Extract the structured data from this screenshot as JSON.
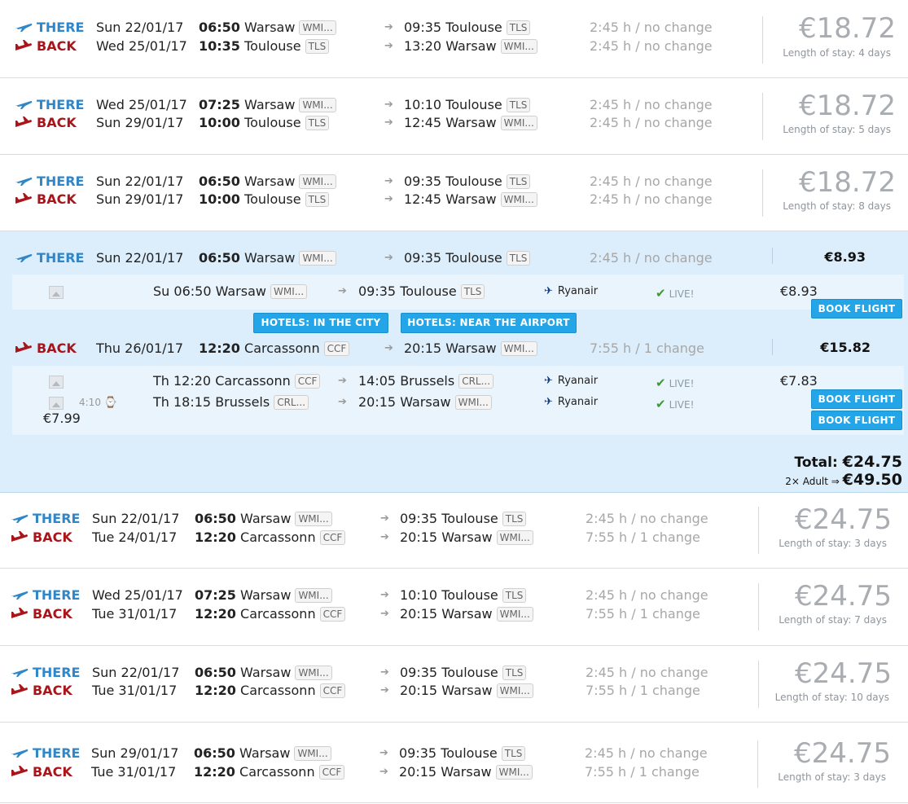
{
  "labels": {
    "there": "THERE",
    "back": "BACK",
    "length_prefix": "Length of stay:",
    "change_sep": " / "
  },
  "results_top": [
    {
      "there": {
        "date": "Sun 22/01/17",
        "dep_time": "06:50",
        "dep_city": "Warsaw",
        "dep_code": "WMI...",
        "arr_time": "09:35",
        "arr_city": "Toulouse",
        "arr_code": "TLS",
        "duration": "2:45 h / no change"
      },
      "back": {
        "date": "Wed 25/01/17",
        "dep_time": "10:35",
        "dep_city": "Toulouse",
        "dep_code": "TLS",
        "arr_time": "13:20",
        "arr_city": "Warsaw",
        "arr_code": "WMI...",
        "duration": "2:45 h / no change"
      },
      "price": "€18.72",
      "stay": "Length of stay: 4 days"
    },
    {
      "there": {
        "date": "Wed 25/01/17",
        "dep_time": "07:25",
        "dep_city": "Warsaw",
        "dep_code": "WMI...",
        "arr_time": "10:10",
        "arr_city": "Toulouse",
        "arr_code": "TLS",
        "duration": "2:45 h / no change"
      },
      "back": {
        "date": "Sun 29/01/17",
        "dep_time": "10:00",
        "dep_city": "Toulouse",
        "dep_code": "TLS",
        "arr_time": "12:45",
        "arr_city": "Warsaw",
        "arr_code": "WMI...",
        "duration": "2:45 h / no change"
      },
      "price": "€18.72",
      "stay": "Length of stay: 5 days"
    },
    {
      "there": {
        "date": "Sun 22/01/17",
        "dep_time": "06:50",
        "dep_city": "Warsaw",
        "dep_code": "WMI...",
        "arr_time": "09:35",
        "arr_city": "Toulouse",
        "arr_code": "TLS",
        "duration": "2:45 h / no change"
      },
      "back": {
        "date": "Sun 29/01/17",
        "dep_time": "10:00",
        "dep_city": "Toulouse",
        "dep_code": "TLS",
        "arr_time": "12:45",
        "arr_city": "Warsaw",
        "arr_code": "WMI...",
        "duration": "2:45 h / no change"
      },
      "price": "€18.72",
      "stay": "Length of stay: 8 days"
    }
  ],
  "expanded": {
    "there": {
      "date": "Sun 22/01/17",
      "dep_time": "06:50",
      "dep_city": "Warsaw",
      "dep_code": "WMI...",
      "arr_time": "09:35",
      "arr_city": "Toulouse",
      "arr_code": "TLS",
      "duration": "2:45 h / no change",
      "price": "€8.93",
      "segments": [
        {
          "dep": "Su 06:50 Warsaw",
          "dep_code": "WMI...",
          "arr": "09:35 Toulouse",
          "arr_code": "TLS",
          "airline": "Ryanair",
          "live": "LIVE!"
        }
      ],
      "seg_price": "€8.93"
    },
    "hotels_city": "HOTELS: IN THE CITY",
    "hotels_airport": "HOTELS: NEAR THE AIRPORT",
    "back": {
      "date": "Thu 26/01/17",
      "dep_time": "12:20",
      "dep_city": "Carcassonn",
      "dep_code": "CCF",
      "arr_time": "20:15",
      "arr_city": "Warsaw",
      "arr_code": "WMI...",
      "duration": "7:55 h / 1 change",
      "price": "€15.82",
      "segments": [
        {
          "dep": "Th 12:20 Carcassonn",
          "dep_code": "CCF",
          "arr": "14:05 Brussels",
          "arr_code": "CRL...",
          "airline": "Ryanair",
          "live": "LIVE!"
        },
        {
          "dep": "Th 18:15 Brussels",
          "dep_code": "CRL...",
          "arr": "20:15 Warsaw",
          "arr_code": "WMI...",
          "airline": "Ryanair",
          "live": "LIVE!"
        }
      ],
      "layover": "4:10",
      "layover_price": "€7.99",
      "seg_price": "€7.83"
    },
    "book_label": "BOOK FLIGHT",
    "total_label": "Total:",
    "total": "€24.75",
    "adult_label": "2× Adult ⇒",
    "adult_total": "€49.50"
  },
  "results_bottom": [
    {
      "there": {
        "date": "Sun 22/01/17",
        "dep_time": "06:50",
        "dep_city": "Warsaw",
        "dep_code": "WMI...",
        "arr_time": "09:35",
        "arr_city": "Toulouse",
        "arr_code": "TLS",
        "duration": "2:45 h / no change"
      },
      "back": {
        "date": "Tue 24/01/17",
        "dep_time": "12:20",
        "dep_city": "Carcassonn",
        "dep_code": "CCF",
        "arr_time": "20:15",
        "arr_city": "Warsaw",
        "arr_code": "WMI...",
        "duration": "7:55 h / 1 change"
      },
      "price": "€24.75",
      "stay": "Length of stay: 3 days"
    },
    {
      "there": {
        "date": "Wed 25/01/17",
        "dep_time": "07:25",
        "dep_city": "Warsaw",
        "dep_code": "WMI...",
        "arr_time": "10:10",
        "arr_city": "Toulouse",
        "arr_code": "TLS",
        "duration": "2:45 h / no change"
      },
      "back": {
        "date": "Tue 31/01/17",
        "dep_time": "12:20",
        "dep_city": "Carcassonn",
        "dep_code": "CCF",
        "arr_time": "20:15",
        "arr_city": "Warsaw",
        "arr_code": "WMI...",
        "duration": "7:55 h / 1 change"
      },
      "price": "€24.75",
      "stay": "Length of stay: 7 days"
    },
    {
      "there": {
        "date": "Sun 22/01/17",
        "dep_time": "06:50",
        "dep_city": "Warsaw",
        "dep_code": "WMI...",
        "arr_time": "09:35",
        "arr_city": "Toulouse",
        "arr_code": "TLS",
        "duration": "2:45 h / no change"
      },
      "back": {
        "date": "Tue 31/01/17",
        "dep_time": "12:20",
        "dep_city": "Carcassonn",
        "dep_code": "CCF",
        "arr_time": "20:15",
        "arr_city": "Warsaw",
        "arr_code": "WMI...",
        "duration": "7:55 h / 1 change"
      },
      "price": "€24.75",
      "stay": "Length of stay: 10 days"
    },
    {
      "there": {
        "date": "Sun 29/01/17",
        "dep_time": "06:50",
        "dep_city": "Warsaw",
        "dep_code": "WMI...",
        "arr_time": "09:35",
        "arr_city": "Toulouse",
        "arr_code": "TLS",
        "duration": "2:45 h / no change"
      },
      "back": {
        "date": "Tue 31/01/17",
        "dep_time": "12:20",
        "dep_city": "Carcassonn",
        "dep_code": "CCF",
        "arr_time": "20:15",
        "arr_city": "Warsaw",
        "arr_code": "WMI...",
        "duration": "7:55 h / 1 change"
      },
      "price": "€24.75",
      "stay": "Length of stay: 3 days"
    }
  ],
  "colors": {
    "there": "#2f86c9",
    "back": "#a8161b",
    "button": "#23a5e8",
    "expanded_bg": "#dcedfb"
  }
}
